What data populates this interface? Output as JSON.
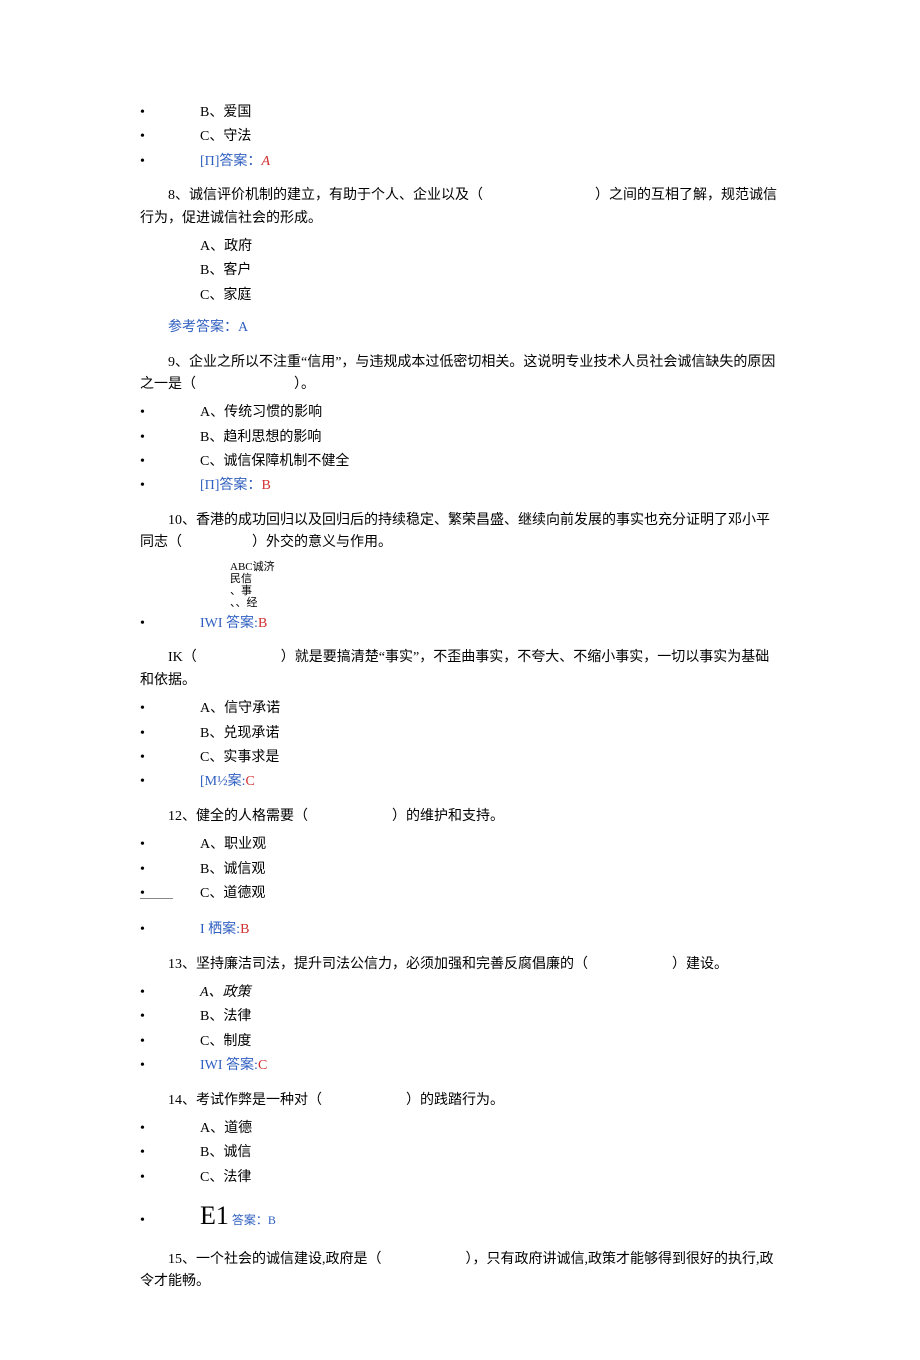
{
  "q7": {
    "optB": "B、爱国",
    "optC": "C、守法",
    "ansLabel": "[Π]答案：",
    "ansVal": "A"
  },
  "q8": {
    "text": "8、诚信评价机制的建立，有助于个人、企业以及（　　　　　　　　）之间的互相了解，规范诚信行为，促进诚信社会的形成。",
    "optA": "A、政府",
    "optB": "B、客户",
    "optC": "C、家庭",
    "refLabel": "参考答案：",
    "refVal": "A"
  },
  "q9": {
    "text": "9、企业之所以不注重“信用”，与违规成本过低密切相关。这说明专业技术人员社会诚信缺失的原因之一是（　　　　　　　）。",
    "optA": "A、传统习惯的影响",
    "optB": "B、趋利思想的影响",
    "optC": "C、诚信保障机制不健全",
    "ansLabel": "[Π]答案：",
    "ansVal": "B"
  },
  "q10": {
    "text": "10、香港的成功回归以及回归后的持续稳定、繁荣昌盛、继续向前发展的事实也充分证明了邓小平同志（　　　　　）外交的意义与作用。",
    "optLine1": "ABC诚济",
    "optLine2": "民信",
    "optLine3": "、事",
    "optLine4": "、、经",
    "ansLabel": "IWI 答案:",
    "ansVal": "B"
  },
  "q11": {
    "text": "IK（　　　　　　）就是要搞清楚“事实”，不歪曲事实，不夸大、不缩小事实，一切以事实为基础和依据。",
    "optA": "A、信守承诺",
    "optB": "B、兑现承诺",
    "optC": "C、实事求是",
    "ansLabel": "[M½案:",
    "ansVal": "C"
  },
  "q12": {
    "text": "12、健全的人格需要（　　　　　　）的维护和支持。",
    "optA": "A、职业观",
    "optB": "B、诚信观",
    "optC": "C、道德观",
    "ansLabel": "I 栖案:",
    "ansVal": "B"
  },
  "q13": {
    "text": "13、坚持廉洁司法，提升司法公信力，必须加强和完善反腐倡廉的（　　　　　　）建设。",
    "optA": "A、政策",
    "optB": "B、法律",
    "optC": "C、制度",
    "ansLabel": "IWI 答案:",
    "ansVal": "C"
  },
  "q14": {
    "text": "14、考试作弊是一种对（　　　　　　）的践踏行为。",
    "optA": "A、道德",
    "optB": "B、诚信",
    "optC": "C、法律",
    "e1": "E1",
    "ansLabel": " 答案：",
    "ansVal": "B"
  },
  "q15": {
    "text": "15、一个社会的诚信建设,政府是（　　　　　　），只有政府讲诚信,政策才能够得到很好的执行,政令才能畅。"
  }
}
